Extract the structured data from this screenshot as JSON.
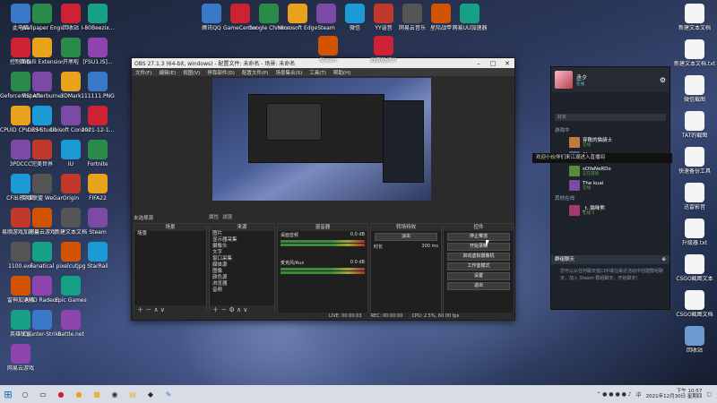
{
  "desktop": {
    "left_col1": [
      "此电脑",
      "控制面板",
      "Geforce Experience",
      "CPUID CPU-Z MSI",
      "3PDCCC",
      "CF出名大师",
      "易顺游戏加速器",
      "1100.exe",
      "雷神加速器",
      "英雄联盟",
      "网易云游戏"
    ],
    "left_col2": [
      "Wallpaper Engine",
      "Intelli Extension",
      "MSI Afterburner",
      "OBS Studio",
      "完美世界",
      "英雄联盟 WeGame",
      "网易云游戏",
      "Fanatical",
      "AMD Radeon",
      "Counter-Strike"
    ],
    "left_col3": [
      "回收站",
      "开黑啦",
      "3DMark",
      "Ubisoft Connect",
      "IU",
      "Origin",
      "新建文本文档",
      "pixelcutjpg",
      "Epic Games",
      "Battle.net"
    ],
    "left_col4": [
      "I-80Beezix...",
      "[FSU1.IS]...",
      "111111.PNG",
      "2021-12-1...",
      "Fortnite",
      "FIFA22",
      "Steam",
      "StarRail"
    ],
    "top_row": [
      "腾讯QQ",
      "GameCenter",
      "Google Chrome",
      "Microsoft Edge",
      "Steam",
      "微信",
      "YY语音",
      "网易云音乐",
      "星际战甲",
      "网易UU加速器"
    ],
    "right_col": [
      "新建文本文档",
      "新建文本文档.txt",
      "微信截图",
      "TAT的截图",
      "快速备份工具",
      "迅雷影音",
      "升级器.txt",
      "CSGO截图文本",
      "CSGO截图文档",
      "回收站"
    ],
    "mid_icons": [
      "Steam",
      "战双帕弥什"
    ]
  },
  "obs": {
    "title": "OBS 27.1.3 (64-bit, windows) - 配置文件: 未命名 - 场景: 未命名",
    "menu": [
      "文件(F)",
      "编辑(E)",
      "视图(V)",
      "停靠部件(D)",
      "配置文件(P)",
      "场景集合(S)",
      "工具(T)",
      "帮助(H)"
    ],
    "current_scene_label": "未选择源",
    "tabs": [
      "属性",
      "滤镜"
    ],
    "docks": {
      "scenes_title": "场景",
      "scenes": [
        "场景"
      ],
      "sources_title": "来源",
      "sources": [
        "图片",
        "显示器采集",
        "摄像头",
        "文字",
        "窗口采集",
        "媒体源",
        "图像",
        "颜色源",
        "浏览器",
        "音频"
      ],
      "mixer_title": "混音器",
      "mixer": [
        {
          "name": "桌面音频",
          "db": "0.0 dB"
        },
        {
          "name": "麦克风/Aux",
          "db": "0.0 dB"
        }
      ],
      "transitions_title": "转场特效",
      "transition_value": "淡出",
      "duration_label": "时长",
      "duration_value": "300 ms",
      "controls_title": "控件",
      "controls": [
        "停止推流",
        "开始录制",
        "启动虚拟摄像机",
        "工作室模式",
        "设置",
        "退出"
      ]
    },
    "status": {
      "live": "LIVE: 00:00:03",
      "rec": "REC: 00:00:00",
      "cpu": "CPU: 2.5%, 60.00 fps"
    }
  },
  "steam": {
    "username": "丞夕",
    "status": "在线",
    "search_placeholder": "好友",
    "group_label": "游戏中",
    "friends": [
      {
        "name": "穿靴的猫骑士",
        "status": "在线",
        "color": "#c47a3a"
      },
      {
        "name": "Akria",
        "status": "在线 - 游戏",
        "color": "#3a6ea5"
      },
      {
        "name": "sOYaNeRDo",
        "status": "正在游戏",
        "color": "#5a8a3a"
      },
      {
        "name": "The kuai",
        "status": "在线",
        "color": "#7a4aa5"
      }
    ],
    "other_online_label": "其他在线",
    "other_friend": {
      "name": "_t..猫咪熊",
      "status": "在线 5"
    },
    "groupchat_label": "群组聊天",
    "groupchat_text": "您可以从任何聊天窗口中或在最近活动中创建群组聊天，加入 Steam 群组聊天，开始聊天！",
    "notice": "欢迎小伙伴们来江湖进入直播间"
  },
  "taskbar": {
    "start_icon": "windows-icon",
    "time": "下午 10:57",
    "date": "2021年12月30日 星期四",
    "lang": "中"
  }
}
